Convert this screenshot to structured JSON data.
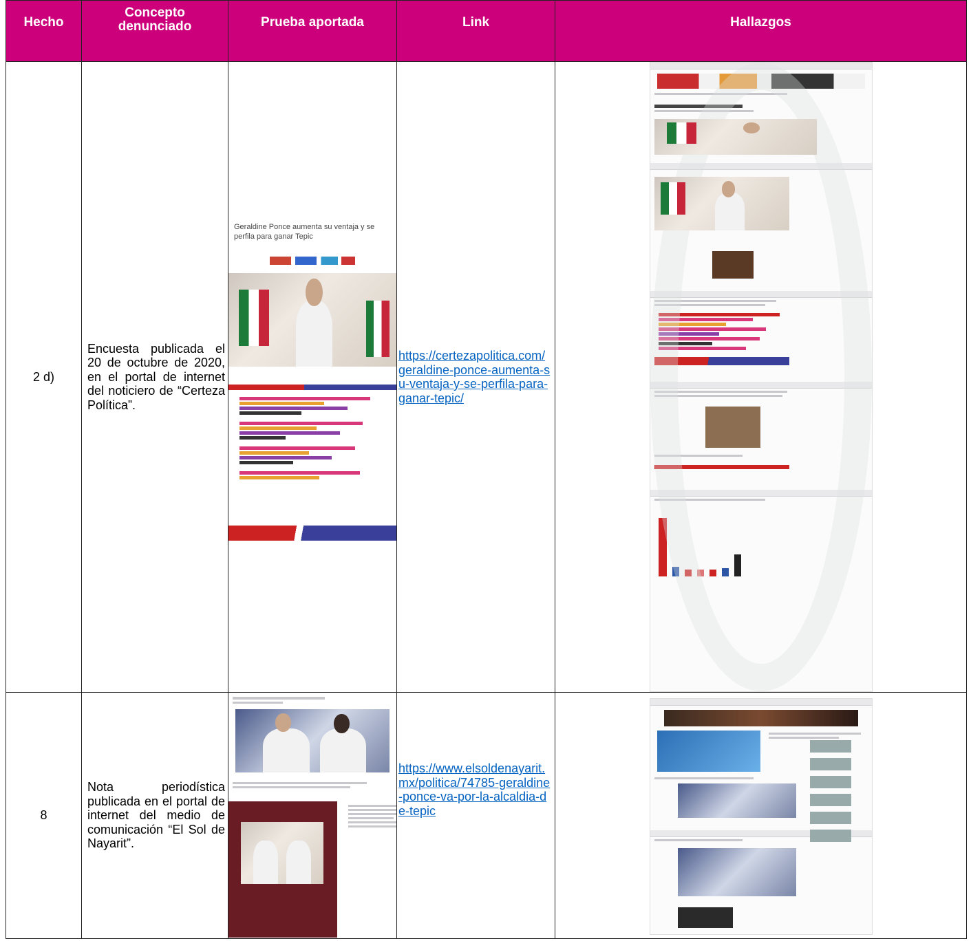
{
  "headers": {
    "hecho": "Hecho",
    "concepto_line1": "Concepto",
    "concepto_line2": "denunciado",
    "prueba": "Prueba aportada",
    "link": "Link",
    "hallazgos": "Hallazgos"
  },
  "rows": [
    {
      "hecho": "2 d)",
      "concepto": "Encuesta publicada el 20 de octubre de 2020, en el portal de internet del noticiero de “Certeza Política”.",
      "prueba_title": "Geraldine Ponce aumenta su ventaja y se perfila para ganar Tepic",
      "link": "https://certezapolitica.com/geraldine-ponce-aumenta-su-ventaja-y-se-perfila-para-ganar-tepic/"
    },
    {
      "hecho": "8",
      "concepto": "Nota periodística publicada en el portal de internet del medio de comunicación “El Sol de Nayarit”.",
      "link": "https://www.elsoldenayarit.mx/politica/74785-geraldine-ponce-va-por-la-alcaldia-de-tepic"
    }
  ],
  "colors": {
    "header_bg": "#cc007a",
    "link": "#0563c1"
  }
}
